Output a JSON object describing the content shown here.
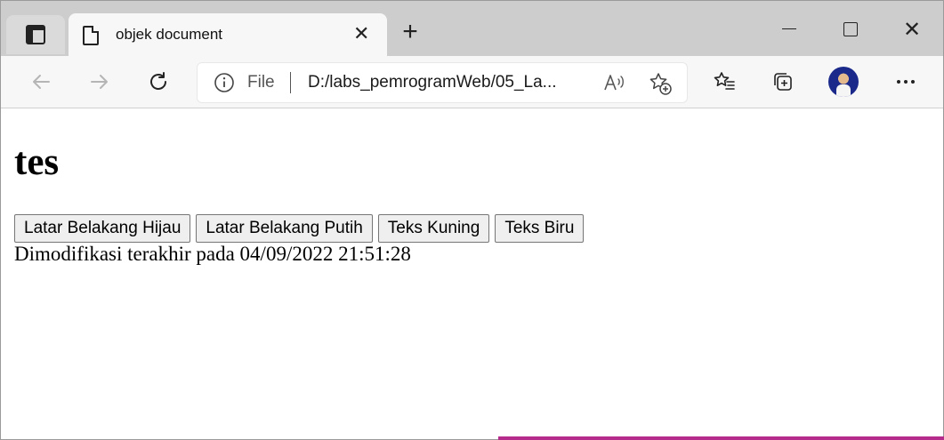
{
  "browser": {
    "tab_title": "objek document",
    "address": {
      "scheme_label": "File",
      "url": "D:/labs_pemrogramWeb/05_La..."
    },
    "icons": {
      "tab_actions": "tab-actions-icon",
      "page": "document-icon",
      "close_tab": "close-icon",
      "new_tab": "plus-icon",
      "minimize": "minimize-icon",
      "maximize": "maximize-icon",
      "close_window": "close-icon",
      "back": "back-arrow-icon",
      "forward": "forward-arrow-icon",
      "refresh": "refresh-icon",
      "info": "info-icon",
      "read_aloud": "read-aloud-icon",
      "add_favorite": "star-add-icon",
      "favorites": "favorites-icon",
      "collections": "collections-icon",
      "more": "more-icon"
    }
  },
  "page": {
    "heading": "tes",
    "buttons": [
      {
        "label": "Latar Belakang Hijau"
      },
      {
        "label": "Latar Belakang Putih"
      },
      {
        "label": "Teks Kuning"
      },
      {
        "label": "Teks Biru"
      }
    ],
    "modified_text": "Dimodifikasi terakhir pada 04/09/2022 21:51:28"
  },
  "colors": {
    "tab_strip": "#cdcdcd",
    "toolbar": "#f7f7f7",
    "page_background": "#ffffff"
  }
}
